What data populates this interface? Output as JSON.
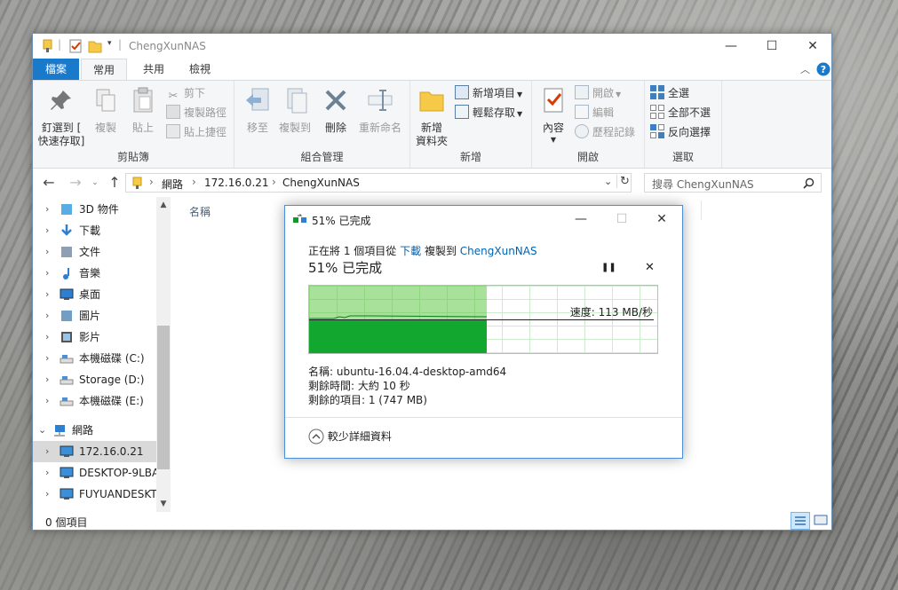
{
  "explorer": {
    "title": "ChengXunNAS",
    "window_buttons": [
      "—",
      "☐",
      "✕"
    ],
    "tabs": {
      "file": "檔案",
      "home": "常用",
      "share": "共用",
      "view": "檢視"
    },
    "ribbon": {
      "clipboard": {
        "label": "剪貼簿",
        "pin": "釘選到 [\n快速存取]",
        "copy": "複製",
        "paste": "貼上",
        "cut": "剪下",
        "copy_path": "複製路徑",
        "paste_shortcut": "貼上捷徑"
      },
      "organize": {
        "label": "組合管理",
        "move_to": "移至",
        "copy_to": "複製到",
        "delete": "刪除",
        "rename": "重新命名"
      },
      "new": {
        "label": "新增",
        "new_folder": "新增\n資料夾",
        "new_item": "新增項目",
        "easy_access": "輕鬆存取"
      },
      "open": {
        "label": "開啟",
        "properties": "內容",
        "open": "開啟",
        "edit": "編輯",
        "history": "歷程記錄"
      },
      "select": {
        "label": "選取",
        "select_all": "全選",
        "select_none": "全部不選",
        "invert": "反向選擇"
      }
    },
    "address": {
      "network": "網路",
      "ip": "172.16.0.21",
      "folder": "ChengXunNAS",
      "sep": "›"
    },
    "search_placeholder": "搜尋 ChengXunNAS",
    "sidebar": [
      {
        "label": "3D 物件",
        "icon": "3d-objects-icon",
        "chev": "›"
      },
      {
        "label": "下載",
        "icon": "downloads-icon",
        "chev": "›"
      },
      {
        "label": "文件",
        "icon": "documents-icon",
        "chev": "›"
      },
      {
        "label": "音樂",
        "icon": "music-icon",
        "chev": "›"
      },
      {
        "label": "桌面",
        "icon": "desktop-icon",
        "chev": "›"
      },
      {
        "label": "圖片",
        "icon": "pictures-icon",
        "chev": "›"
      },
      {
        "label": "影片",
        "icon": "videos-icon",
        "chev": "›"
      },
      {
        "label": "本機磁碟 (C:)",
        "icon": "drive-c-icon",
        "chev": "›"
      },
      {
        "label": "Storage (D:)",
        "icon": "drive-d-icon",
        "chev": "›"
      },
      {
        "label": "本機磁碟 (E:)",
        "icon": "drive-e-icon",
        "chev": "›"
      },
      {
        "label": "網路",
        "icon": "network-icon",
        "chev": "⌄"
      },
      {
        "label": "172.16.0.21",
        "icon": "computer-icon",
        "chev": "›"
      },
      {
        "label": "DESKTOP-9LBA",
        "icon": "computer-icon",
        "chev": "›"
      },
      {
        "label": "FUYUANDESKT",
        "icon": "computer-icon",
        "chev": "›"
      }
    ],
    "column_header": "名稱",
    "status": "0 個項目"
  },
  "dialog": {
    "title": "51% 已完成",
    "copy_prefix": "正在將 1 個項目從",
    "source": "下載",
    "copy_mid": "複製到",
    "destination": "ChengXunNAS",
    "percent_text": "51% 已完成",
    "progress": 0.51,
    "speed": "速度: 113 MB/秒",
    "name": "名稱: ubuntu-16.04.4-desktop-amd64",
    "time_left": "剩餘時間: 大約 10 秒",
    "items_left": "剩餘的項目: 1 (747 MB)",
    "less_details": "較少詳細資料",
    "pause": "❚❚",
    "cancel": "✕",
    "window_buttons": [
      "—",
      "☐",
      "✕"
    ]
  },
  "colors": {
    "file_tab": "#1979ca",
    "progress_light": "#a8e19a",
    "progress_dark": "#12a82f",
    "link": "#0063b1"
  }
}
